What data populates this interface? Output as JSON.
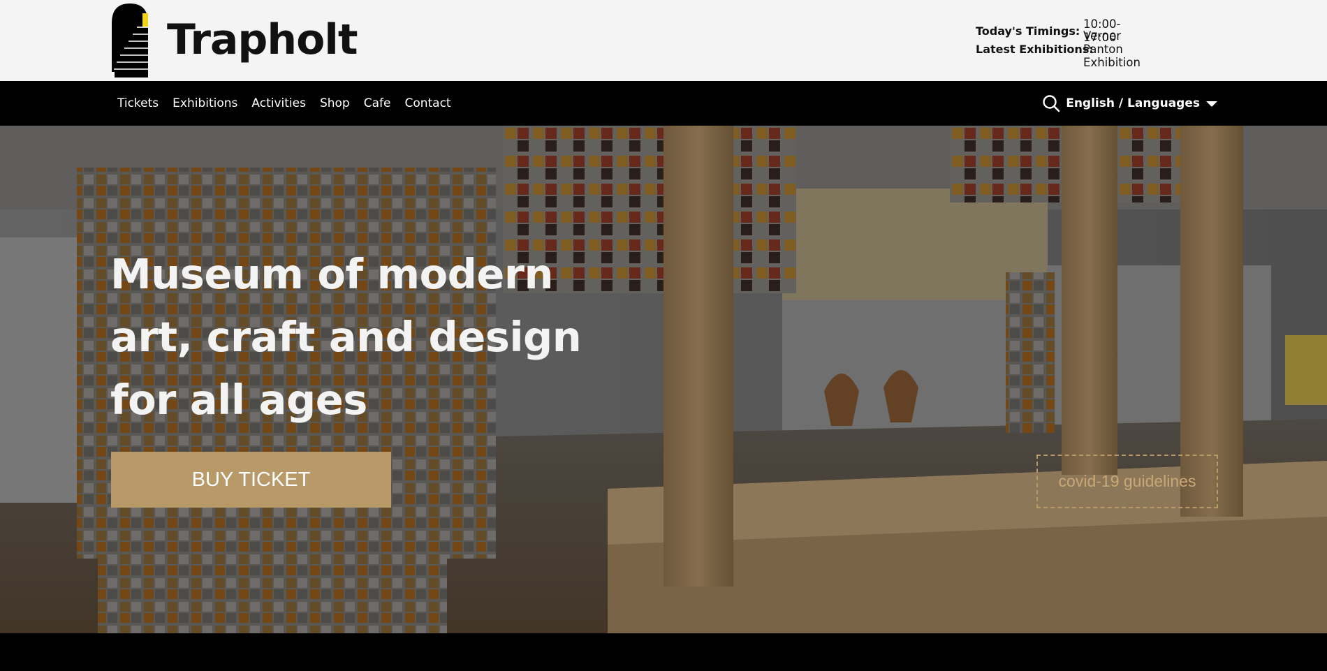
{
  "brand": {
    "name": "Trapholt",
    "logo_icon": "staircase-arch-logo"
  },
  "info": {
    "timings_label": "Today's Timings:",
    "timings_value": "10:00-17:00",
    "exhibitions_label": "Latest Exhibitions:",
    "exhibitions_value": "Verner Panton Exhibition"
  },
  "nav": {
    "items": [
      {
        "label": "Tickets"
      },
      {
        "label": "Exhibitions"
      },
      {
        "label": "Activities"
      },
      {
        "label": "Shop"
      },
      {
        "label": "Cafe"
      },
      {
        "label": "Contact"
      }
    ],
    "search_icon": "search-icon",
    "language_label": "English / Languages"
  },
  "hero": {
    "title": "Museum of modern art, craft and design for all ages",
    "buy_label": "BUY TICKET",
    "covid_label": "covid-19 guidelines"
  },
  "colors": {
    "accent": "#b89968",
    "topbar_bg": "#f4f4f4",
    "nav_bg": "#000000"
  }
}
